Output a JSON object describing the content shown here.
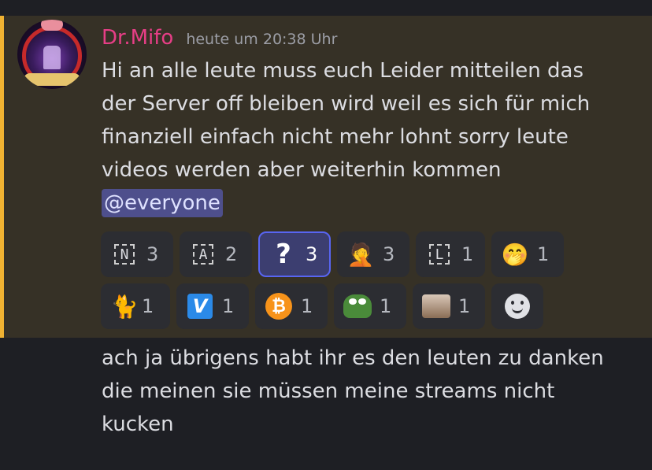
{
  "message": {
    "username": "Dr.Mifo",
    "timestamp": "heute um 20:38 Uhr",
    "line1": "Hi an alle leute muss euch Leider mitteilen das",
    "line2": "der Server off bleiben wird weil es sich für mich",
    "line3": "finanziell einfach nicht mehr lohnt sorry leute",
    "line4": "videos werden aber weiterhin kommen",
    "mention": "@everyone",
    "colors": {
      "username": "#e63e86",
      "mention_bar": "#f0b232",
      "mention_bg": "#4e4f8c",
      "active_reaction_border": "#5865f2"
    }
  },
  "reactions": [
    {
      "icon": "regional-indicator-n",
      "glyph": "N",
      "count": "3",
      "active": false
    },
    {
      "icon": "regional-indicator-a",
      "glyph": "A",
      "count": "2",
      "active": false
    },
    {
      "icon": "question-mark",
      "glyph": "?",
      "count": "3",
      "active": true
    },
    {
      "icon": "facepalm-emoji",
      "glyph": "🤦",
      "count": "3",
      "active": false
    },
    {
      "icon": "regional-indicator-l",
      "glyph": "L",
      "count": "1",
      "active": false
    },
    {
      "icon": "face-with-hand-over-mouth-emoji",
      "glyph": "🤭",
      "count": "1",
      "active": false
    },
    {
      "icon": "cat-emoji",
      "glyph": "🐈",
      "count": "1",
      "active": false
    },
    {
      "icon": "venmo-logo",
      "glyph": "V",
      "count": "1",
      "active": false
    },
    {
      "icon": "bitcoin-logo",
      "glyph": "₿",
      "count": "1",
      "active": false
    },
    {
      "icon": "pepe-frog-emoji",
      "glyph": "",
      "count": "1",
      "active": false
    },
    {
      "icon": "cat-photo-emoji",
      "glyph": "",
      "count": "1",
      "active": false
    }
  ],
  "add_reaction_icon": "add-reaction-smiley-icon",
  "followup": {
    "line1": "ach ja übrigens habt ihr es den leuten zu danken",
    "line2": "die meinen sie müssen meine streams nicht",
    "line3": "kucken"
  }
}
